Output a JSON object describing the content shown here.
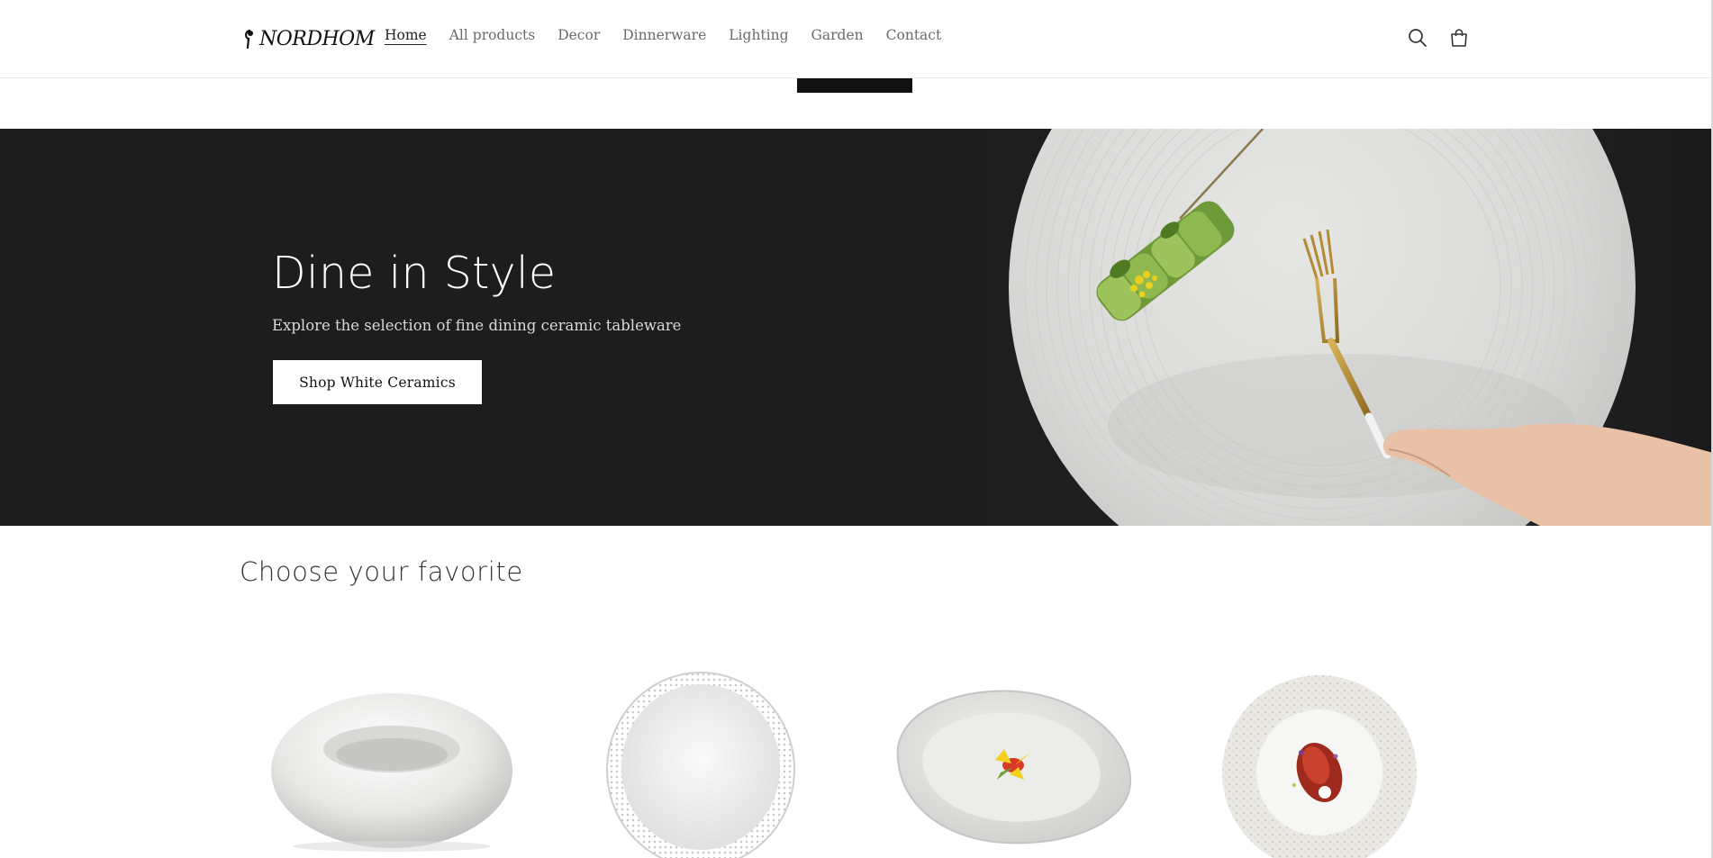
{
  "header": {
    "logo_text": "NORDHOM",
    "nav": [
      {
        "label": "Home",
        "active": true
      },
      {
        "label": "All products"
      },
      {
        "label": "Decor"
      },
      {
        "label": "Dinnerware"
      },
      {
        "label": "Lighting"
      },
      {
        "label": "Garden"
      },
      {
        "label": "Contact"
      }
    ],
    "icons": [
      "search-icon",
      "cart-icon"
    ]
  },
  "hero": {
    "title": "Dine in Style",
    "subtitle": "Explore the selection of fine dining ceramic tableware",
    "button_label": "Shop White Ceramics",
    "background_color": "#1d1d1d"
  },
  "favorites": {
    "title": "Choose your favorite",
    "products": [
      {
        "image": "donut-bowl-image"
      },
      {
        "image": "textured-oval-plate-image"
      },
      {
        "image": "organic-bowl-image"
      },
      {
        "image": "textured-rim-plate-image"
      }
    ]
  }
}
